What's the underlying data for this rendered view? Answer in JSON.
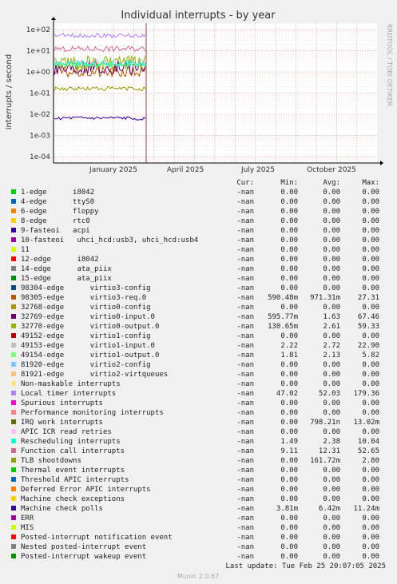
{
  "chart_data": {
    "type": "line",
    "title": "Individual interrupts - by year",
    "ylabel": "interrupts / second",
    "y_scale": "log",
    "ylim": [
      5e-05,
      200
    ],
    "y_ticks": [
      "1e+02",
      "1e+01",
      "1e+00",
      "1e-01",
      "1e-02",
      "1e-03",
      "1e-04"
    ],
    "x_ticks": [
      "January 2025",
      "April 2025",
      "July 2025",
      "October 2025"
    ],
    "grid": true,
    "side_label": "RRDTOOL / TOBI OETIKER",
    "columns": [
      "Cur:",
      "Min:",
      "Avg:",
      "Max:"
    ],
    "series": [
      {
        "name": "1-edge      i8042",
        "color": "#00cc00",
        "cur": "-nan",
        "min": "0.00",
        "avg": "0.00",
        "max": "0.00"
      },
      {
        "name": "4-edge      ttyS0",
        "color": "#0066b3",
        "cur": "-nan",
        "min": "0.00",
        "avg": "0.00",
        "max": "0.00"
      },
      {
        "name": "6-edge      floppy",
        "color": "#ff8000",
        "cur": "-nan",
        "min": "0.00",
        "avg": "0.00",
        "max": "0.00"
      },
      {
        "name": "8-edge      rtc0",
        "color": "#ffcc00",
        "cur": "-nan",
        "min": "0.00",
        "avg": "0.00",
        "max": "0.00"
      },
      {
        "name": "9-fasteoi   acpi",
        "color": "#330099",
        "cur": "-nan",
        "min": "0.00",
        "avg": "0.00",
        "max": "0.00"
      },
      {
        "name": "10-fasteoi   uhci_hcd:usb3, uhci_hcd:usb4",
        "color": "#990099",
        "cur": "-nan",
        "min": "0.00",
        "avg": "0.00",
        "max": "0.00"
      },
      {
        "name": "11",
        "color": "#ccff00",
        "cur": "-nan",
        "min": "0.00",
        "avg": "0.00",
        "max": "0.00"
      },
      {
        "name": "12-edge      i8042",
        "color": "#ff0000",
        "cur": "-nan",
        "min": "0.00",
        "avg": "0.00",
        "max": "0.00"
      },
      {
        "name": "14-edge      ata_piix",
        "color": "#808080",
        "cur": "-nan",
        "min": "0.00",
        "avg": "0.00",
        "max": "0.00"
      },
      {
        "name": "15-edge      ata_piix",
        "color": "#008f00",
        "cur": "-nan",
        "min": "0.00",
        "avg": "0.00",
        "max": "0.00"
      },
      {
        "name": "98304-edge      virtio3-config",
        "color": "#00487d",
        "cur": "-nan",
        "min": "0.00",
        "avg": "0.00",
        "max": "0.00"
      },
      {
        "name": "98305-edge      virtio3-req.0",
        "color": "#b35a00",
        "cur": "-nan",
        "min": "590.48m",
        "avg": "971.31m",
        "max": "27.31"
      },
      {
        "name": "32768-edge      virtio0-config",
        "color": "#b38f00",
        "cur": "-nan",
        "min": "0.00",
        "avg": "0.00",
        "max": "0.00"
      },
      {
        "name": "32769-edge      virtio0-input.0",
        "color": "#6b006b",
        "cur": "-nan",
        "min": "595.77m",
        "avg": "1.63",
        "max": "67.46"
      },
      {
        "name": "32770-edge      virtio0-output.0",
        "color": "#8fb300",
        "cur": "-nan",
        "min": "130.65m",
        "avg": "2.61",
        "max": "59.33"
      },
      {
        "name": "49152-edge      virtio1-config",
        "color": "#b30000",
        "cur": "-nan",
        "min": "0.00",
        "avg": "0.00",
        "max": "0.00"
      },
      {
        "name": "49153-edge      virtio1-input.0",
        "color": "#bebebe",
        "cur": "-nan",
        "min": "2.22",
        "avg": "2.72",
        "max": "22.90"
      },
      {
        "name": "49154-edge      virtio1-output.0",
        "color": "#80ff80",
        "cur": "-nan",
        "min": "1.81",
        "avg": "2.13",
        "max": "5.82"
      },
      {
        "name": "81920-edge      virtio2-config",
        "color": "#80c9ff",
        "cur": "-nan",
        "min": "0.00",
        "avg": "0.00",
        "max": "0.00"
      },
      {
        "name": "81921-edge      virtio2-virtqueues",
        "color": "#ffc080",
        "cur": "-nan",
        "min": "0.00",
        "avg": "0.00",
        "max": "0.00"
      },
      {
        "name": "Non-maskable interrupts",
        "color": "#ffe680",
        "cur": "-nan",
        "min": "0.00",
        "avg": "0.00",
        "max": "0.00"
      },
      {
        "name": "Local timer interrupts",
        "color": "#aa80ff",
        "cur": "-nan",
        "min": "47.02",
        "avg": "52.03",
        "max": "179.36"
      },
      {
        "name": "Spurious interrupts",
        "color": "#ee00cc",
        "cur": "-nan",
        "min": "0.00",
        "avg": "0.00",
        "max": "0.00"
      },
      {
        "name": "Performance monitoring interrupts",
        "color": "#ff8080",
        "cur": "-nan",
        "min": "0.00",
        "avg": "0.00",
        "max": "0.00"
      },
      {
        "name": "IRQ work interrupts",
        "color": "#666600",
        "cur": "-nan",
        "min": "0.00",
        "avg": "798.21n",
        "max": "13.02m"
      },
      {
        "name": "APIC ICR read retries",
        "color": "#ffbfff",
        "cur": "-nan",
        "min": "0.00",
        "avg": "0.00",
        "max": "0.00"
      },
      {
        "name": "Rescheduling interrupts",
        "color": "#00ffcc",
        "cur": "-nan",
        "min": "1.49",
        "avg": "2.38",
        "max": "10.04"
      },
      {
        "name": "Function call interrupts",
        "color": "#cc6699",
        "cur": "-nan",
        "min": "9.11",
        "avg": "12.31",
        "max": "52.65"
      },
      {
        "name": "TLB shootdowns",
        "color": "#999900",
        "cur": "-nan",
        "min": "0.00",
        "avg": "161.72m",
        "max": "2.80"
      },
      {
        "name": "Thermal event interrupts",
        "color": "#00cc00",
        "cur": "-nan",
        "min": "0.00",
        "avg": "0.00",
        "max": "0.00"
      },
      {
        "name": "Threshold APIC interrupts",
        "color": "#0066b3",
        "cur": "-nan",
        "min": "0.00",
        "avg": "0.00",
        "max": "0.00"
      },
      {
        "name": "Deferred Error APIC interrupts",
        "color": "#ff8000",
        "cur": "-nan",
        "min": "0.00",
        "avg": "0.00",
        "max": "0.00"
      },
      {
        "name": "Machine check exceptions",
        "color": "#ffcc00",
        "cur": "-nan",
        "min": "0.00",
        "avg": "0.00",
        "max": "0.00"
      },
      {
        "name": "Machine check polls",
        "color": "#330099",
        "cur": "-nan",
        "min": "3.81m",
        "avg": "6.42m",
        "max": "11.24m"
      },
      {
        "name": "ERR",
        "color": "#990099",
        "cur": "-nan",
        "min": "0.00",
        "avg": "0.00",
        "max": "0.00"
      },
      {
        "name": "MIS",
        "color": "#ccff00",
        "cur": "-nan",
        "min": "0.00",
        "avg": "0.00",
        "max": "0.00"
      },
      {
        "name": "Posted-interrupt notification event",
        "color": "#ff0000",
        "cur": "-nan",
        "min": "0.00",
        "avg": "0.00",
        "max": "0.00"
      },
      {
        "name": "Nested posted-interrupt event",
        "color": "#808080",
        "cur": "-nan",
        "min": "0.00",
        "avg": "0.00",
        "max": "0.00"
      },
      {
        "name": "Posted-interrupt wakeup event",
        "color": "#008f00",
        "cur": "-nan",
        "min": "0.00",
        "avg": "0.00",
        "max": "0.00"
      }
    ],
    "last_update": "Last update: Tue Feb 25 20:07:05 2025",
    "footer": "Munin 2.0.67"
  }
}
